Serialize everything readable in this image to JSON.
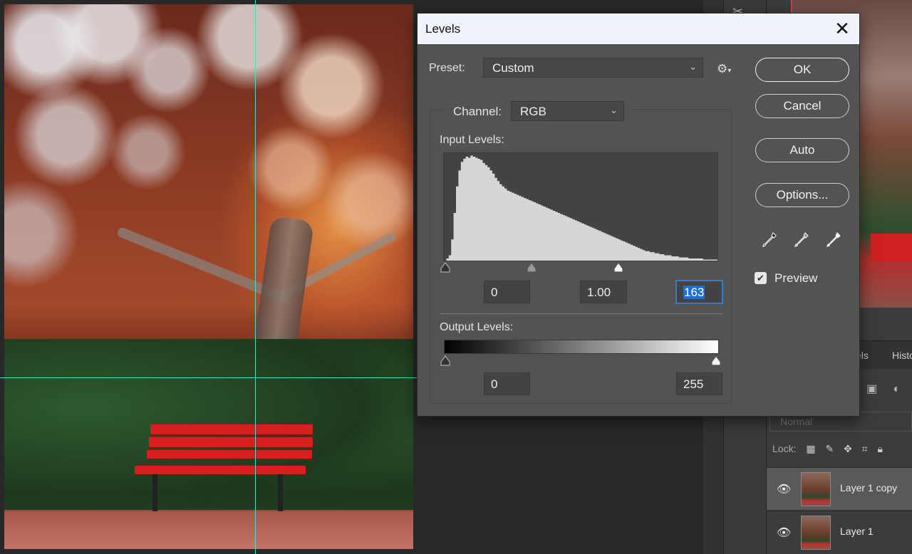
{
  "dialog": {
    "title": "Levels",
    "preset_label": "Preset:",
    "preset_value": "Custom",
    "channel_label": "Channel:",
    "channel_value": "RGB",
    "input_levels_label": "Input Levels:",
    "input_black": "0",
    "input_gamma": "1.00",
    "input_white": "163",
    "output_levels_label": "Output Levels:",
    "output_black": "0",
    "output_white": "255",
    "buttons": {
      "ok": "OK",
      "cancel": "Cancel",
      "auto": "Auto",
      "options": "Options..."
    },
    "preview_label": "Preview",
    "preview_checked": true
  },
  "histogram": {
    "levels": [
      0,
      2,
      5,
      20,
      45,
      70,
      85,
      93,
      96,
      98,
      97,
      99,
      98,
      97,
      96,
      95,
      92,
      90,
      88,
      85,
      82,
      78,
      75,
      72,
      70,
      68,
      66,
      65,
      64,
      63,
      62,
      61,
      60,
      59,
      58,
      57,
      56,
      55,
      54,
      53,
      52,
      51,
      50,
      49,
      48,
      47,
      46,
      45,
      44,
      43,
      42,
      41,
      40,
      39,
      38,
      37,
      36,
      35,
      34,
      33,
      32,
      31,
      30,
      29,
      28,
      27,
      26,
      25,
      24,
      23,
      22,
      21,
      20,
      19,
      18,
      17,
      16,
      15,
      14,
      13,
      12,
      11,
      10,
      9,
      9,
      8,
      8,
      7,
      7,
      6,
      6,
      5,
      5,
      5,
      4,
      4,
      4,
      3,
      3,
      3,
      3,
      2,
      2,
      2,
      2,
      2,
      2,
      1,
      1,
      1,
      1,
      1,
      1
    ],
    "color": "#d6d6d6"
  },
  "side_panels": {
    "tabs": [
      "els",
      "Histo"
    ],
    "blend_mode": "Normal",
    "lock_label": "Lock:",
    "layers": [
      {
        "name": "Layer 1 copy",
        "active": true
      },
      {
        "name": "Layer 1",
        "active": false
      }
    ]
  }
}
